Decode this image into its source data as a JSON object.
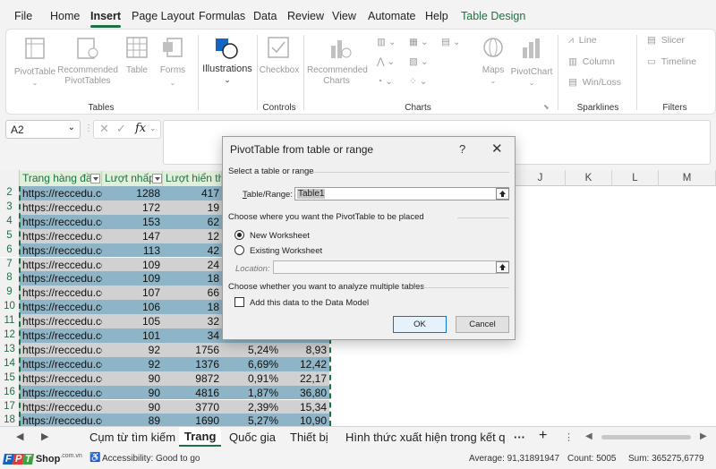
{
  "menu": {
    "tabs": [
      {
        "label": "File"
      },
      {
        "label": "Home"
      },
      {
        "label": "Insert"
      },
      {
        "label": "Page Layout"
      },
      {
        "label": "Formulas"
      },
      {
        "label": "Data"
      },
      {
        "label": "Review"
      },
      {
        "label": "View"
      },
      {
        "label": "Automate"
      },
      {
        "label": "Help"
      },
      {
        "label": "Table Design"
      }
    ],
    "active_tab": "Insert",
    "accent_color": "#1e7145"
  },
  "ribbon": {
    "groups": {
      "tables": "Tables",
      "controls": "Controls",
      "charts": "Charts",
      "sparklines": "Sparklines",
      "filters": "Filters"
    },
    "pivottable": "PivotTable",
    "recommended_pivottables_1": "Recommended",
    "recommended_pivottables_2": "PivotTables",
    "table": "Table",
    "forms": "Forms",
    "illustrations": "Illustrations",
    "checkbox": "Checkbox",
    "recommended_charts_1": "Recommended",
    "recommended_charts_2": "Charts",
    "maps": "Maps",
    "pivotchart": "PivotChart",
    "line": "Line",
    "column": "Column",
    "win_loss": "Win/Loss",
    "slicer": "Slicer",
    "timeline": "Timeline"
  },
  "formula_bar": {
    "name_box": "A2",
    "fx": "fx"
  },
  "columns": {
    "J": "J",
    "K": "K",
    "L": "L",
    "M": "M"
  },
  "table": {
    "headers": [
      "Trang hàng đầu",
      "Lượt nhấp",
      "Lượt hiển thị"
    ],
    "rows": [
      {
        "num": "2",
        "url": "https://reccedu.co",
        "clicks": "1288",
        "impr": "417",
        "ctr": "",
        "pos": ""
      },
      {
        "num": "3",
        "url": "https://reccedu.co",
        "clicks": "172",
        "impr": "19",
        "ctr": "",
        "pos": ""
      },
      {
        "num": "4",
        "url": "https://reccedu.co",
        "clicks": "153",
        "impr": "62",
        "ctr": "",
        "pos": ""
      },
      {
        "num": "5",
        "url": "https://reccedu.co",
        "clicks": "147",
        "impr": "12",
        "ctr": "",
        "pos": ""
      },
      {
        "num": "6",
        "url": "https://reccedu.co",
        "clicks": "113",
        "impr": "42",
        "ctr": "",
        "pos": ""
      },
      {
        "num": "7",
        "url": "https://reccedu.co",
        "clicks": "109",
        "impr": "24",
        "ctr": "",
        "pos": ""
      },
      {
        "num": "8",
        "url": "https://reccedu.co",
        "clicks": "109",
        "impr": "18",
        "ctr": "",
        "pos": ""
      },
      {
        "num": "9",
        "url": "https://reccedu.co",
        "clicks": "107",
        "impr": "66",
        "ctr": "",
        "pos": ""
      },
      {
        "num": "10",
        "url": "https://reccedu.co",
        "clicks": "106",
        "impr": "18",
        "ctr": "",
        "pos": ""
      },
      {
        "num": "11",
        "url": "https://reccedu.co",
        "clicks": "105",
        "impr": "32",
        "ctr": "",
        "pos": ""
      },
      {
        "num": "12",
        "url": "https://reccedu.co",
        "clicks": "101",
        "impr": "34",
        "ctr": "",
        "pos": ""
      },
      {
        "num": "13",
        "url": "https://reccedu.co",
        "clicks": "92",
        "impr": "1756",
        "ctr": "5,24%",
        "pos": "8,93"
      },
      {
        "num": "14",
        "url": "https://reccedu.co",
        "clicks": "92",
        "impr": "1376",
        "ctr": "6,69%",
        "pos": "12,42"
      },
      {
        "num": "15",
        "url": "https://reccedu.co",
        "clicks": "90",
        "impr": "9872",
        "ctr": "0,91%",
        "pos": "22,17"
      },
      {
        "num": "16",
        "url": "https://reccedu.co",
        "clicks": "90",
        "impr": "4816",
        "ctr": "1,87%",
        "pos": "36,80"
      },
      {
        "num": "17",
        "url": "https://reccedu.co",
        "clicks": "90",
        "impr": "3770",
        "ctr": "2,39%",
        "pos": "15,34"
      },
      {
        "num": "18",
        "url": "https://reccedu.co",
        "clicks": "89",
        "impr": "1690",
        "ctr": "5,27%",
        "pos": "10,90"
      }
    ]
  },
  "sheets": {
    "tabs": [
      "Cụm từ tìm kiếm",
      "Trang",
      "Quốc gia",
      "Thiết bị",
      "Hình thức xuất hiện trong kết q"
    ],
    "active": "Trang",
    "more": "···",
    "add": "+"
  },
  "status": {
    "brand": "FPT Shop",
    "brand_suffix": ".com.vn",
    "accessibility": "Accessibility: Good to go",
    "average": "Average: 91,31891947",
    "count": "Count: 5005",
    "sum": "Sum: 365275,6779"
  },
  "dialog": {
    "title": "PivotTable from table or range",
    "help": "?",
    "close": "✕",
    "section_select": "Select a table or range",
    "table_range_label": "Table/Range:",
    "table_range_value": "Table1",
    "section_place": "Choose where you want the PivotTable to be placed",
    "new_worksheet": "New Worksheet",
    "existing_worksheet": "Existing Worksheet",
    "location_label": "Location:",
    "location_value": "",
    "section_multiple": "Choose whether you want to analyze multiple tables",
    "add_data_model": "Add this data to the Data Model",
    "ok": "OK",
    "cancel": "Cancel",
    "selected_option": "New Worksheet",
    "add_data_model_checked": false
  }
}
